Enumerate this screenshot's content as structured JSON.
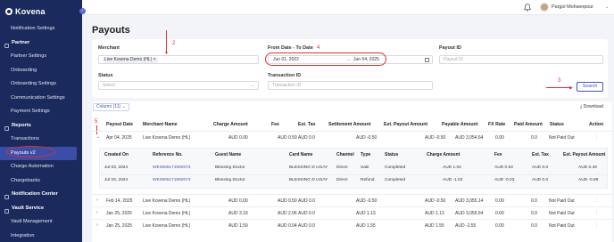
{
  "brand": {
    "name": "Kovena"
  },
  "sidebar": {
    "items": [
      {
        "kind": "item",
        "label": "Notification Settings"
      },
      {
        "kind": "section",
        "label": "Partner",
        "icon": "users-icon"
      },
      {
        "kind": "item",
        "label": "Partner Settings"
      },
      {
        "kind": "item",
        "label": "Onboarding"
      },
      {
        "kind": "item",
        "label": "Onboarding Settings"
      },
      {
        "kind": "item",
        "label": "Communication Settings"
      },
      {
        "kind": "item",
        "label": "Payment Settings"
      },
      {
        "kind": "section",
        "label": "Reports",
        "icon": "report-icon"
      },
      {
        "kind": "item",
        "label": "Transactions"
      },
      {
        "kind": "item",
        "label": "Payouts v2",
        "active": true
      },
      {
        "kind": "item",
        "label": "Charge Automation"
      },
      {
        "kind": "item",
        "label": "Chargebacks"
      },
      {
        "kind": "section",
        "label": "Notification Center",
        "icon": "bell-icon"
      },
      {
        "kind": "section",
        "label": "Vault Service",
        "icon": "shield-icon"
      },
      {
        "kind": "item",
        "label": "Vault Management"
      },
      {
        "kind": "item",
        "label": "Integration"
      }
    ]
  },
  "topbar": {
    "user_name": "Pargol Mohsenpour"
  },
  "page": {
    "title": "Payouts"
  },
  "filters": {
    "merchant_label": "Merchant",
    "merchant_value": "Live Kovena Demo (HL)",
    "date_label": "From Date - To Date",
    "date_from": "Jun 01, 2022",
    "date_arrow": "→",
    "date_to": "Jun 04, 2025",
    "payout_id_label": "Payout ID",
    "payout_id_placeholder": "Payout ID",
    "status_label": "Status",
    "status_placeholder": "Select",
    "transaction_id_label": "Transaction ID",
    "transaction_id_placeholder": "Transaction ID",
    "search_label": "Search"
  },
  "annotations": [
    "2",
    "3",
    "4",
    "5"
  ],
  "table": {
    "column_button": "Column (11)",
    "download_label": "Download",
    "headers": [
      "Payout Date",
      "Merchant Name",
      "Charge Amount",
      "Fee",
      "Est. Tax",
      "Settlement Amount",
      "Est. Payout Amount",
      "Payable Amount",
      "FX Rate",
      "Paid Amount",
      "Status",
      "Action"
    ],
    "rows": [
      {
        "date": "Apr 04, 2025",
        "merchant": "Live Kovena Demo (HL)",
        "charge": "AUD 0.00",
        "fee": "AUD 0.50",
        "tax": "AUD 0.0",
        "settlement": "AUD -0.50",
        "est_payout": "AUD -0.50",
        "payable": "AUD 3,054.64",
        "fx": "0.00",
        "paid": "0.0",
        "status": "Not Paid Out",
        "expanded": true
      },
      {
        "date": "Feb 14, 2025",
        "merchant": "Live Kovena Demo (HL)",
        "charge": "AUD 0.00",
        "fee": "AUD 0.50",
        "tax": "AUD 0.0",
        "settlement": "AUD -0.50",
        "est_payout": "AUD -0.50",
        "payable": "AUD 3,055.14",
        "fx": "0.00",
        "paid": "0.0",
        "status": "Not Paid Out"
      },
      {
        "date": "Jan 25, 2025",
        "merchant": "Live Kovena Demo (HL)",
        "charge": "AUD 3.19",
        "fee": "AUD 2.06",
        "tax": "AUD 0.0",
        "settlement": "AUD 1.13",
        "est_payout": "AUD 1.13",
        "payable": "AUD 3,055.64",
        "fx": "0.00",
        "paid": "0.0",
        "status": "Not Paid Out"
      },
      {
        "date": "Jan 25, 2025",
        "merchant": "Live Kovena Demo (HL)",
        "charge": "AUD 1.59",
        "fee": "AUD 0.04",
        "tax": "AUD 0.0",
        "settlement": "AUD 1.55",
        "est_payout": "AUD 1.55",
        "payable": "AUD -2.55",
        "fx": "0.00",
        "paid": "0.0",
        "status": "Not Paid Out"
      }
    ],
    "sub_headers": [
      "Created On",
      "Reference No.",
      "Guest Name",
      "Card Name",
      "Channel",
      "Type",
      "Status",
      "Charge Amount",
      "Fee",
      "Est. Tax",
      "Est. Payout Amount"
    ],
    "sub_rows": [
      {
        "created": "Jul 03, 2024",
        "ref": "WE3865171992673",
        "guest": "Blessing Doctor",
        "card": "BLESSING D UGAY",
        "channel": "Direct",
        "type": "Sale",
        "status": "Completed",
        "charge": "AUD 1.02",
        "fee": "AUD 0.53",
        "tax": "AUD 0.0",
        "payout": "AUD 0.49"
      },
      {
        "created": "Jul 03, 2024",
        "ref": "WE3865171992673",
        "guest": "Blessing Doctor",
        "card": "BLESSING D UGAY",
        "channel": "Direct",
        "type": "Refund",
        "status": "Completed",
        "charge": "AUD -1.02",
        "fee": "AUD -0.03",
        "tax": "AUD 0.0",
        "payout": "AUD -0.99"
      }
    ]
  },
  "colors": {
    "sidebar": "#1b2a5c",
    "accent": "#4355b9",
    "annotation": "#e0322e"
  }
}
